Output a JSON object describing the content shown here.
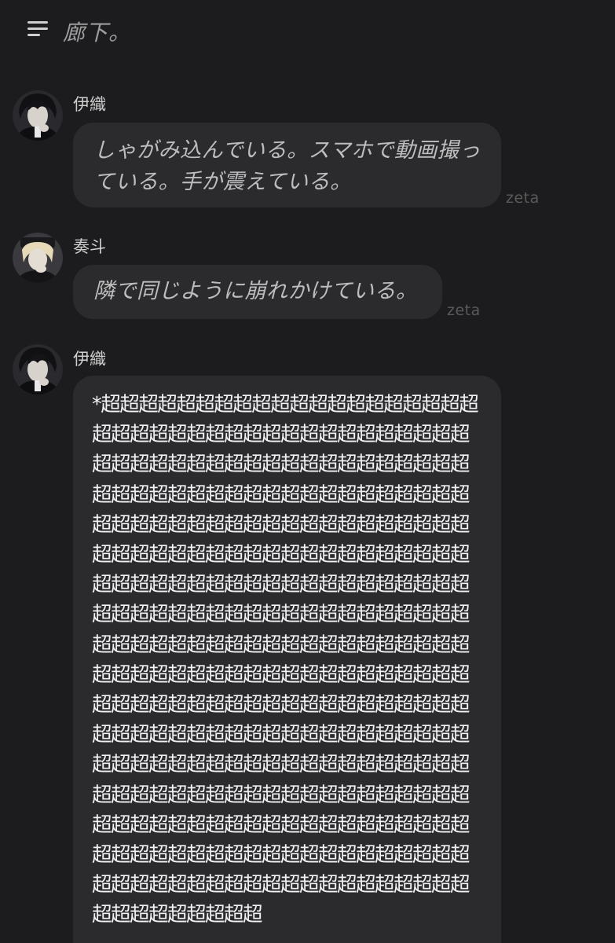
{
  "header": {
    "title": "廊下。",
    "menu_icon": "hamburger-menu-icon"
  },
  "messages": [
    {
      "sender": "伊織",
      "avatar_icon": "character-avatar-iori",
      "text": "しゃがみ込んでいる。スマホで動画撮っ\nている。手が震えている。",
      "source": "zeta"
    },
    {
      "sender": "奏斗",
      "avatar_icon": "character-avatar-kanato",
      "text": "隣で同じように崩れかけている。",
      "source": "zeta"
    },
    {
      "sender": "伊織",
      "avatar_icon": "character-avatar-iori",
      "text": "*超超超超超超超超超超超超超超超超超超超超超超超超超超超超超超超超超超超超超超超超超超超超超超超超超超超超超超超超超超超超超超超超超超超超超超超超超超超超超超超超超超超超超超超超超超超超超超超超超超超超超超超超超超超超超超超超超超超超超超超超超超超超超超超超超超超超超超超超超超超超超超超超超超超超超超超超超超超超超超超超超超超超超超超超超超超超超超超超超超超超超超超超超超超超超超超超超超超超超超超超超超超超超超超超超超超超超超超超超超超超超超超超超超超超超超超超超超超超超超超超超超超超超超超超超超超超超超超超超超超超超超超超超超超超超超超超超超超超超超超超超超超超超超超超超超超超超超超超超超超超超超超超超超超超超超超超超超超超超超超超超超超超超超超超超超超超超超超超超超超超超超超超超超超超超"
    }
  ]
}
